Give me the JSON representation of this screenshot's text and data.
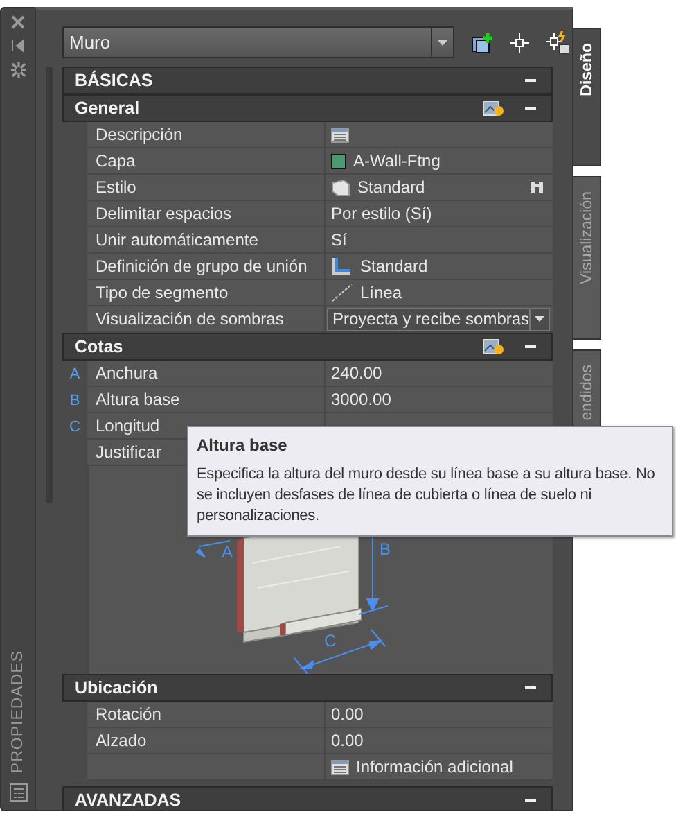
{
  "side_strip": {
    "title": "PROPIEDADES"
  },
  "object_selector": {
    "value": "Muro"
  },
  "tabs": [
    {
      "label": "Diseño",
      "selected": true
    },
    {
      "label": "Visualización",
      "selected": false
    },
    {
      "label": "endidos",
      "selected": false
    }
  ],
  "sections": [
    {
      "title": "BÁSICAS",
      "kind": "category",
      "expanded": true
    },
    {
      "title": "General",
      "kind": "group",
      "expanded": true,
      "picker_button": true,
      "rows": [
        {
          "label": "Descripción",
          "kind": "description"
        },
        {
          "label": "Capa",
          "kind": "layer",
          "value": "A-Wall-Ftng"
        },
        {
          "label": "Estilo",
          "kind": "style",
          "value": "Standard"
        },
        {
          "label": "Delimitar espacios",
          "kind": "text",
          "value": "Por estilo (Sí)"
        },
        {
          "label": "Unir automáticamente",
          "kind": "text",
          "value": "Sí"
        },
        {
          "label": "Definición de grupo de unión",
          "kind": "joint",
          "value": "Standard"
        },
        {
          "label": "Tipo de segmento",
          "kind": "segment",
          "value": "Línea"
        },
        {
          "label": "Visualización de sombras",
          "kind": "dropdown",
          "value": "Proyecta y recibe sombras"
        }
      ]
    },
    {
      "title": "Cotas",
      "kind": "group",
      "expanded": true,
      "picker_button": true,
      "rows": [
        {
          "marker": "A",
          "label": "Anchura",
          "kind": "text",
          "value": "240.00"
        },
        {
          "marker": "B",
          "label": "Altura base",
          "kind": "text",
          "value": "3000.00"
        },
        {
          "marker": "C",
          "label": "Longitud",
          "kind": "text"
        },
        {
          "label": "Justificar",
          "kind": "text"
        },
        {
          "kind": "diagram",
          "labels": [
            "A",
            "B",
            "C"
          ]
        }
      ]
    },
    {
      "title": "Ubicación",
      "kind": "group",
      "expanded": true,
      "picker_button": false,
      "rows": [
        {
          "label": "Rotación",
          "kind": "text",
          "value": "0.00"
        },
        {
          "label": "Alzado",
          "kind": "text",
          "value": "0.00"
        },
        {
          "kind": "link",
          "value": "Información adicional"
        }
      ]
    },
    {
      "title": "AVANZADAS",
      "kind": "category",
      "expanded": true
    }
  ],
  "tooltip": {
    "title": "Altura base",
    "text": "Especifica la altura del muro desde su línea base a su altura base. No se incluyen desfases de línea de cubierta o línea de suelo ni personalizaciones."
  }
}
